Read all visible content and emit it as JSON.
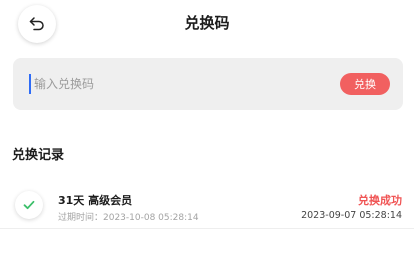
{
  "header": {
    "title": "兑换码",
    "back_icon": "back-arrow-icon"
  },
  "redeem": {
    "placeholder": "输入兑换码",
    "button_label": "兑换",
    "button_color": "#f16060",
    "cursor_color": "#2f6cf6"
  },
  "history": {
    "title": "兑换记录",
    "records": [
      {
        "title": "31天 高级会员",
        "expire": "过期时间：2023-10-08 05:28:14",
        "status": "兑换成功",
        "time": "2023-09-07 05:28:14",
        "status_color": "#f05454",
        "icon": "check-icon"
      }
    ]
  }
}
